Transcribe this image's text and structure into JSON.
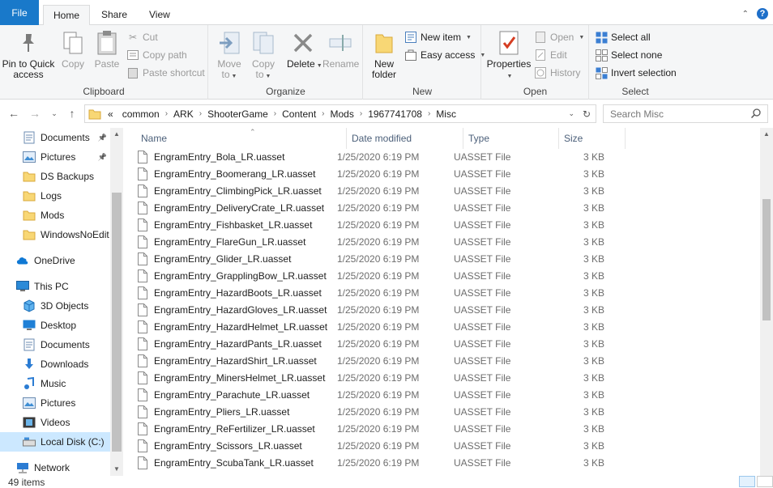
{
  "tabs": {
    "file": "File",
    "home": "Home",
    "share": "Share",
    "view": "View"
  },
  "ribbon": {
    "clipboard": {
      "label": "Clipboard",
      "pin": "Pin to Quick access",
      "copy": "Copy",
      "paste": "Paste",
      "cut": "Cut",
      "copy_path": "Copy path",
      "paste_shortcut": "Paste shortcut"
    },
    "organize": {
      "label": "Organize",
      "move_to": "Move to",
      "copy_to": "Copy to",
      "delete": "Delete",
      "rename": "Rename"
    },
    "new": {
      "label": "New",
      "new_folder": "New folder",
      "new_item": "New item",
      "easy_access": "Easy access"
    },
    "open": {
      "label": "Open",
      "properties": "Properties",
      "open": "Open",
      "edit": "Edit",
      "history": "History"
    },
    "select": {
      "label": "Select",
      "select_all": "Select all",
      "select_none": "Select none",
      "invert": "Invert selection"
    }
  },
  "address": {
    "overflow": "«",
    "crumbs": [
      "common",
      "ARK",
      "ShooterGame",
      "Content",
      "Mods",
      "1967741708",
      "Misc"
    ],
    "search_placeholder": "Search Misc"
  },
  "nav": {
    "items": [
      {
        "label": "Documents",
        "icon": "documents-icon",
        "pinned": true
      },
      {
        "label": "Pictures",
        "icon": "pictures-icon",
        "pinned": true
      },
      {
        "label": "DS Backups",
        "icon": "folder-icon"
      },
      {
        "label": "Logs",
        "icon": "folder-icon"
      },
      {
        "label": "Mods",
        "icon": "folder-icon"
      },
      {
        "label": "WindowsNoEdit",
        "icon": "folder-icon"
      },
      {
        "label": "OneDrive",
        "icon": "cloud-icon"
      },
      {
        "label": "This PC",
        "icon": "computer-icon"
      },
      {
        "label": "3D Objects",
        "icon": "3d-objects-icon"
      },
      {
        "label": "Desktop",
        "icon": "desktop-icon"
      },
      {
        "label": "Documents",
        "icon": "documents-icon"
      },
      {
        "label": "Downloads",
        "icon": "download-icon"
      },
      {
        "label": "Music",
        "icon": "music-icon"
      },
      {
        "label": "Pictures",
        "icon": "pictures-icon"
      },
      {
        "label": "Videos",
        "icon": "videos-icon"
      },
      {
        "label": "Local Disk (C:)",
        "icon": "drive-icon",
        "selected": true
      },
      {
        "label": "Network",
        "icon": "network-icon"
      }
    ]
  },
  "columns": {
    "name": "Name",
    "date": "Date modified",
    "type": "Type",
    "size": "Size"
  },
  "files": [
    {
      "name": "EngramEntry_Bola_LR.uasset",
      "date": "1/25/2020 6:19 PM",
      "type": "UASSET File",
      "size": "3 KB"
    },
    {
      "name": "EngramEntry_Boomerang_LR.uasset",
      "date": "1/25/2020 6:19 PM",
      "type": "UASSET File",
      "size": "3 KB"
    },
    {
      "name": "EngramEntry_ClimbingPick_LR.uasset",
      "date": "1/25/2020 6:19 PM",
      "type": "UASSET File",
      "size": "3 KB"
    },
    {
      "name": "EngramEntry_DeliveryCrate_LR.uasset",
      "date": "1/25/2020 6:19 PM",
      "type": "UASSET File",
      "size": "3 KB"
    },
    {
      "name": "EngramEntry_Fishbasket_LR.uasset",
      "date": "1/25/2020 6:19 PM",
      "type": "UASSET File",
      "size": "3 KB"
    },
    {
      "name": "EngramEntry_FlareGun_LR.uasset",
      "date": "1/25/2020 6:19 PM",
      "type": "UASSET File",
      "size": "3 KB"
    },
    {
      "name": "EngramEntry_Glider_LR.uasset",
      "date": "1/25/2020 6:19 PM",
      "type": "UASSET File",
      "size": "3 KB"
    },
    {
      "name": "EngramEntry_GrapplingBow_LR.uasset",
      "date": "1/25/2020 6:19 PM",
      "type": "UASSET File",
      "size": "3 KB"
    },
    {
      "name": "EngramEntry_HazardBoots_LR.uasset",
      "date": "1/25/2020 6:19 PM",
      "type": "UASSET File",
      "size": "3 KB"
    },
    {
      "name": "EngramEntry_HazardGloves_LR.uasset",
      "date": "1/25/2020 6:19 PM",
      "type": "UASSET File",
      "size": "3 KB"
    },
    {
      "name": "EngramEntry_HazardHelmet_LR.uasset",
      "date": "1/25/2020 6:19 PM",
      "type": "UASSET File",
      "size": "3 KB"
    },
    {
      "name": "EngramEntry_HazardPants_LR.uasset",
      "date": "1/25/2020 6:19 PM",
      "type": "UASSET File",
      "size": "3 KB"
    },
    {
      "name": "EngramEntry_HazardShirt_LR.uasset",
      "date": "1/25/2020 6:19 PM",
      "type": "UASSET File",
      "size": "3 KB"
    },
    {
      "name": "EngramEntry_MinersHelmet_LR.uasset",
      "date": "1/25/2020 6:19 PM",
      "type": "UASSET File",
      "size": "3 KB"
    },
    {
      "name": "EngramEntry_Parachute_LR.uasset",
      "date": "1/25/2020 6:19 PM",
      "type": "UASSET File",
      "size": "3 KB"
    },
    {
      "name": "EngramEntry_Pliers_LR.uasset",
      "date": "1/25/2020 6:19 PM",
      "type": "UASSET File",
      "size": "3 KB"
    },
    {
      "name": "EngramEntry_ReFertilizer_LR.uasset",
      "date": "1/25/2020 6:19 PM",
      "type": "UASSET File",
      "size": "3 KB"
    },
    {
      "name": "EngramEntry_Scissors_LR.uasset",
      "date": "1/25/2020 6:19 PM",
      "type": "UASSET File",
      "size": "3 KB"
    },
    {
      "name": "EngramEntry_ScubaTank_LR.uasset",
      "date": "1/25/2020 6:19 PM",
      "type": "UASSET File",
      "size": "3 KB"
    }
  ],
  "status": {
    "count": "49 items"
  },
  "colors": {
    "accent": "#1979ca",
    "selection": "#cce8ff",
    "folder": "#f8d775"
  }
}
